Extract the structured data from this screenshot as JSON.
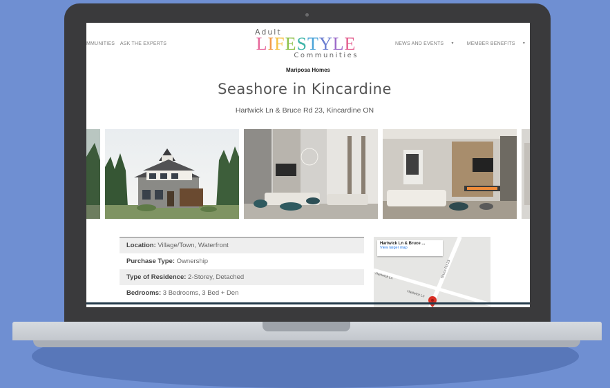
{
  "nav": {
    "left_items": [
      "MMUNITIES",
      "ASK THE EXPERTS"
    ],
    "right_items": [
      "NEWS AND EVENTS",
      "MEMBER BENEFITS"
    ]
  },
  "logo": {
    "top": "Adult",
    "main_letters": [
      "L",
      "I",
      "F",
      "E",
      "S",
      "T",
      "Y",
      "L",
      "E"
    ],
    "main_colors": [
      "#e7689b",
      "#f29b49",
      "#f5c243",
      "#8fc24c",
      "#3fb5a9",
      "#4aa3d8",
      "#6c7fd1",
      "#9d6bc9",
      "#e35f8f"
    ],
    "bottom": "Communities"
  },
  "listing": {
    "builder": "Mariposa Homes",
    "title": "Seashore in Kincardine",
    "address": "Hartwick Ln & Bruce Rd 23, Kincardine ON"
  },
  "details": [
    {
      "label": "Location:",
      "value": " Village/Town, Waterfront"
    },
    {
      "label": "Purchase Type:",
      "value": " Ownership"
    },
    {
      "label": "Type of Residence:",
      "value": " 2-Storey, Detached"
    },
    {
      "label": "Bedrooms:",
      "value": " 3 Bedrooms, 3 Bed + Den"
    }
  ],
  "map": {
    "card_title": "Hartwick Ln & Bruce ...",
    "card_link": "View larger map",
    "road_labels": [
      "Bruce Rd 23",
      "Hartwick Ln",
      "Hartwick Ln"
    ]
  },
  "colors": {
    "background": "#6f8fd2",
    "laptop": "#3a3a3c",
    "pin": "#d93025"
  }
}
